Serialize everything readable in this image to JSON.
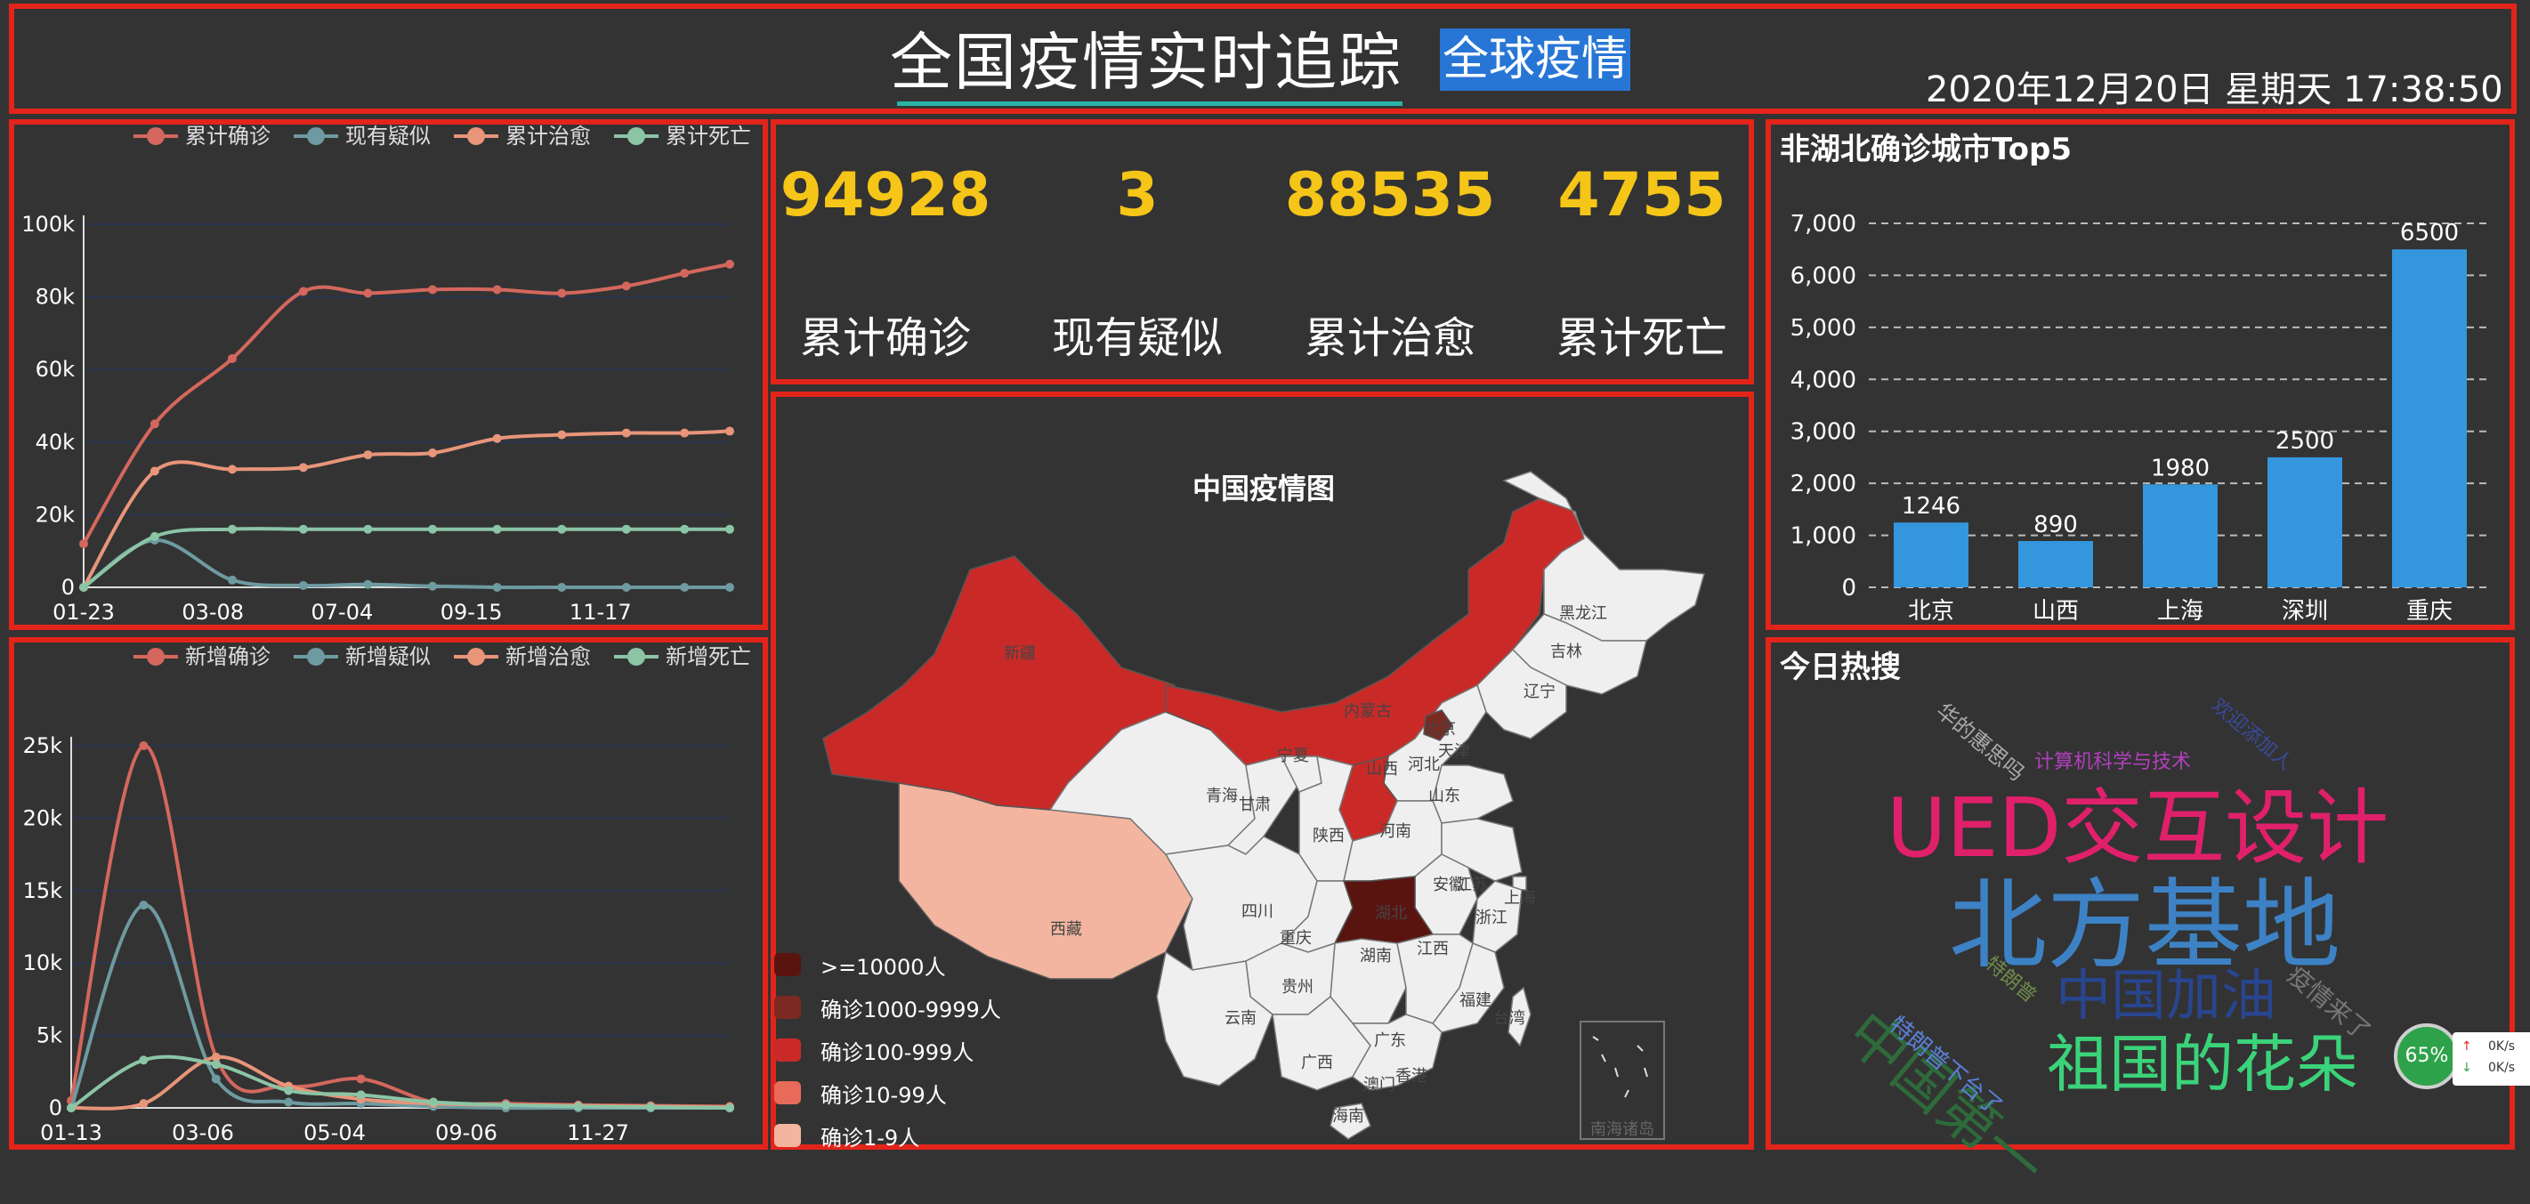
{
  "header": {
    "title": "全国疫情实时追踪",
    "global_button": "全球疫情",
    "datetime": "2020年12月20日 星期天 17:38:50"
  },
  "stats": [
    {
      "value": "94928",
      "label": "累计确诊"
    },
    {
      "value": "3",
      "label": "现有疑似"
    },
    {
      "value": "88535",
      "label": "累计治愈"
    },
    {
      "value": "4755",
      "label": "累计死亡"
    }
  ],
  "colors": {
    "confirm": "#d4675d",
    "suspect": "#6e9aa1",
    "heal": "#e8957a",
    "dead": "#8bc5a6",
    "bar": "#3496dd",
    "accent": "#f5c518",
    "border": "#e3241b"
  },
  "chart_data": [
    {
      "type": "line",
      "legend": [
        "累计确诊",
        "现有疑似",
        "累计治愈",
        "累计死亡"
      ],
      "x_ticks": [
        "01-23",
        "03-08",
        "07-04",
        "09-15",
        "11-17"
      ],
      "y_ticks": [
        "0",
        "20k",
        "40k",
        "60k",
        "80k",
        "100k"
      ],
      "ylim": [
        0,
        100000
      ],
      "series": [
        {
          "name": "累计确诊",
          "x": [
            0,
            0.11,
            0.23,
            0.34,
            0.44,
            0.54,
            0.64,
            0.74,
            0.84,
            0.93,
            1.0
          ],
          "values": [
            12000,
            45000,
            63000,
            81500,
            81000,
            82000,
            82000,
            81000,
            83000,
            86500,
            89000
          ]
        },
        {
          "name": "现有疑似",
          "x": [
            0,
            0.11,
            0.23,
            0.34,
            0.44,
            0.54,
            0.64,
            0.74,
            0.84,
            0.93,
            1.0
          ],
          "values": [
            0,
            13000,
            2000,
            500,
            800,
            300,
            0,
            0,
            0,
            0,
            0
          ]
        },
        {
          "name": "累计治愈",
          "x": [
            0,
            0.11,
            0.23,
            0.34,
            0.44,
            0.54,
            0.64,
            0.74,
            0.84,
            0.93,
            1.0
          ],
          "values": [
            0,
            32000,
            32500,
            33000,
            36500,
            37000,
            41000,
            42000,
            42500,
            42500,
            43000
          ]
        },
        {
          "name": "累计死亡",
          "x": [
            0,
            0.11,
            0.23,
            0.34,
            0.44,
            0.54,
            0.64,
            0.74,
            0.84,
            0.93,
            1.0
          ],
          "values": [
            0,
            14000,
            16000,
            16000,
            16000,
            16000,
            16000,
            16000,
            16000,
            16000,
            16000
          ]
        }
      ]
    },
    {
      "type": "line",
      "legend": [
        "新增确诊",
        "新增疑似",
        "新增治愈",
        "新增死亡"
      ],
      "x_ticks": [
        "01-13",
        "03-06",
        "05-04",
        "09-06",
        "11-27"
      ],
      "y_ticks": [
        "0",
        "5k",
        "10k",
        "15k",
        "20k",
        "25k"
      ],
      "ylim": [
        0,
        25000
      ],
      "series": [
        {
          "name": "新增确诊",
          "x": [
            0,
            0.11,
            0.22,
            0.33,
            0.44,
            0.55,
            0.66,
            0.77,
            0.88,
            1.0
          ],
          "values": [
            500,
            25000,
            3500,
            1500,
            2000,
            400,
            300,
            200,
            150,
            100
          ]
        },
        {
          "name": "新增疑似",
          "x": [
            0,
            0.11,
            0.22,
            0.33,
            0.44,
            0.55,
            0.66,
            0.77,
            0.88,
            1.0
          ],
          "values": [
            0,
            14000,
            2000,
            400,
            300,
            100,
            0,
            0,
            0,
            0
          ]
        },
        {
          "name": "新增治愈",
          "x": [
            0,
            0.11,
            0.22,
            0.33,
            0.44,
            0.55,
            0.66,
            0.77,
            0.88,
            1.0
          ],
          "values": [
            0,
            300,
            3500,
            1500,
            600,
            300,
            200,
            150,
            100,
            50
          ]
        },
        {
          "name": "新增死亡",
          "x": [
            0,
            0.11,
            0.22,
            0.33,
            0.44,
            0.55,
            0.66,
            0.77,
            0.88,
            1.0
          ],
          "values": [
            0,
            3300,
            3000,
            1200,
            900,
            400,
            200,
            100,
            50,
            0
          ]
        }
      ]
    },
    {
      "type": "bar",
      "title": "非湖北确诊城市Top5",
      "categories": [
        "北京",
        "山西",
        "上海",
        "深圳",
        "重庆"
      ],
      "values": [
        1246,
        890,
        1980,
        2500,
        6500
      ],
      "y_ticks": [
        "0",
        "1,000",
        "2,000",
        "3,000",
        "4,000",
        "5,000",
        "6,000",
        "7,000"
      ],
      "ylim": [
        0,
        7000
      ]
    }
  ],
  "map": {
    "title": "中国疫情图",
    "legend": [
      {
        "label": ">=10000人",
        "color": "#5a1410"
      },
      {
        "label": "确诊1000-9999人",
        "color": "#7b2a22"
      },
      {
        "label": "确诊100-999人",
        "color": "#c92a28"
      },
      {
        "label": "确诊10-99人",
        "color": "#e86a5a"
      },
      {
        "label": "确诊1-9人",
        "color": "#f3b5a0"
      }
    ],
    "provinces": [
      "黑龙江",
      "吉林",
      "辽宁",
      "内蒙古",
      "北京",
      "天津",
      "河北",
      "山西",
      "山东",
      "宁夏",
      "甘肃",
      "青海",
      "新疆",
      "西藏",
      "陕西",
      "河南",
      "江苏",
      "安徽",
      "上海",
      "浙江",
      "四川",
      "湖北",
      "重庆",
      "湖南",
      "江西",
      "贵州",
      "云南",
      "福建",
      "广西",
      "广东",
      "台湾",
      "香港",
      "澳门",
      "海南"
    ],
    "inset_label": "南海诸岛"
  },
  "hot": {
    "title": "今日热搜",
    "words": [
      "UED交互设计",
      "北方基地",
      "中国加油",
      "中国第一",
      "祖国的花朵",
      "计算机科学与技术",
      "华的惠思吗",
      "欢迎添加人",
      "疫情来了",
      "特朗普",
      "特朗普下台了"
    ]
  },
  "widget": {
    "percent": "65%",
    "up": "0K/s",
    "down": "0K/s"
  }
}
